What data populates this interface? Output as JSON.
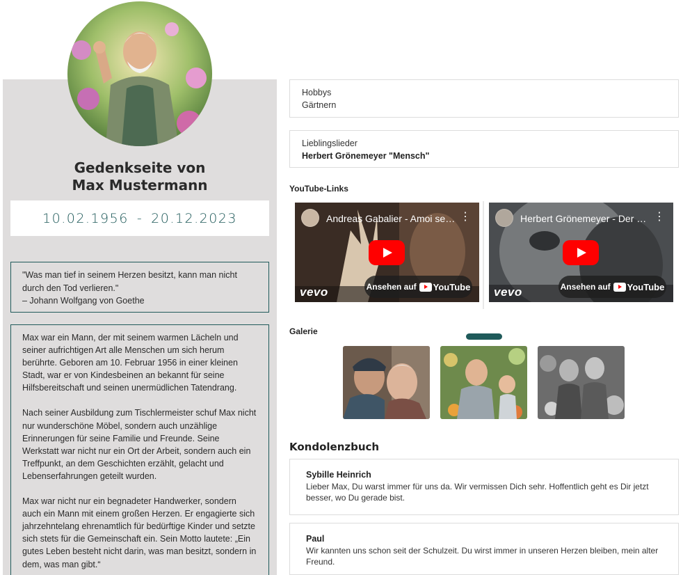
{
  "memorial": {
    "title_line1": "Gedenkseite von",
    "title_line2": "Max Mustermann",
    "birth_date": "10.02.1956",
    "date_separator": "-",
    "death_date": "20.12.2023",
    "quote_text": "\"Was man tief in seinem Herzen besitzt, kann man nicht durch den Tod verlieren.\"",
    "quote_author": "– Johann Wolfgang von Goethe",
    "bio": [
      "Max war ein Mann, der mit seinem warmen Lächeln und seiner aufrichtigen Art alle Menschen um sich herum berührte. Geboren am 10. Februar 1956 in einer kleinen Stadt, war er von Kindesbeinen an bekannt für seine Hilfsbereitschaft und seinen unermüdlichen Tatendrang.",
      "Nach seiner Ausbildung zum Tischlermeister schuf Max nicht nur wunderschöne Möbel, sondern auch unzählige Erinnerungen für seine Familie und Freunde. Seine Werkstatt war nicht nur ein Ort der Arbeit, sondern auch ein Treffpunkt, an dem Geschichten erzählt, gelacht und Lebenserfahrungen geteilt wurden.",
      "Max war nicht nur ein begnadeter Handwerker, sondern auch ein Mann mit einem großen Herzen. Er engagierte sich jahrzehntelang ehrenamtlich für bedürftige Kinder und setzte sich stets für die Gemeinschaft ein. Sein Motto lautete: „Ein gutes Leben besteht nicht darin, was man besitzt, sondern in dem, was man gibt.“"
    ]
  },
  "hobbies": {
    "label": "Hobbys",
    "value": "Gärtnern"
  },
  "songs": {
    "label": "Lieblingslieder",
    "value": "Herbert Grönemeyer \"Mensch\""
  },
  "youtube": {
    "label": "YouTube-Links",
    "videos": [
      {
        "title": "Andreas Gabalier - Amoi seg' ma uns wieder",
        "watch_label": "Ansehen auf",
        "platform": "YouTube",
        "brand": "vevo"
      },
      {
        "title": "Herbert Grönemeyer - Der Weg",
        "watch_label": "Ansehen auf",
        "platform": "YouTube",
        "brand": "vevo"
      }
    ]
  },
  "gallery": {
    "label": "Galerie"
  },
  "condolences": {
    "title": "Kondolenzbuch",
    "entries": [
      {
        "name": "Sybille Heinrich",
        "text": "Lieber Max, Du warst immer für uns da. Wir vermissen Dich sehr. Hoffentlich geht es Dir jetzt besser, wo Du gerade bist."
      },
      {
        "name": "Paul",
        "text": "Wir kannten uns schon seit der Schulzeit. Du wirst immer in unseren Herzen bleiben, mein alter Freund."
      }
    ]
  },
  "icons": {
    "play": "play-button-icon",
    "kebab": "more-vertical-icon",
    "youtube_logo": "youtube-logo-icon"
  },
  "colors": {
    "accent": "#1f5a5a",
    "panel_bg": "#dfdddd",
    "youtube_red": "#ff0000"
  }
}
